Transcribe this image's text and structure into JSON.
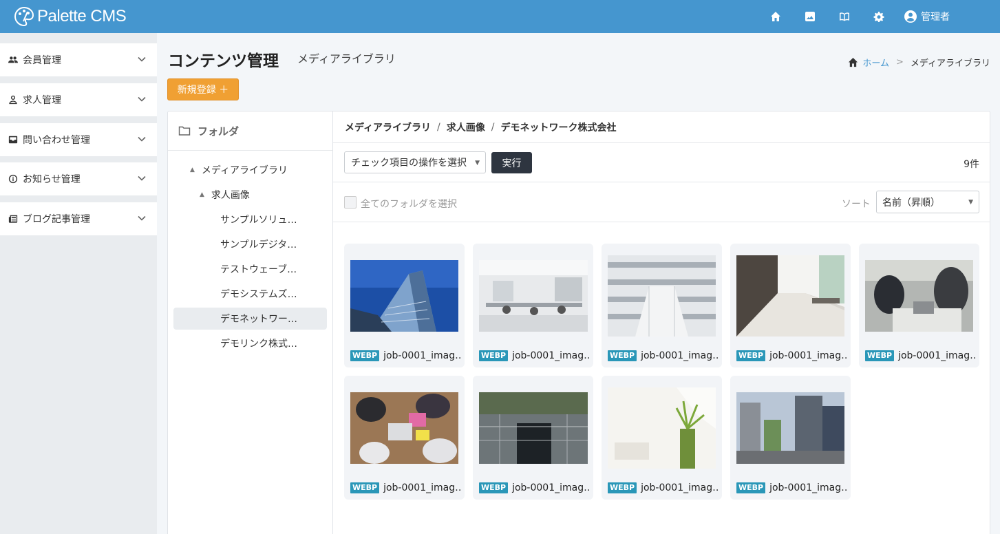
{
  "app": {
    "name": "Palette CMS"
  },
  "topbar": {
    "icons": [
      "home-icon",
      "image-icon",
      "book-icon",
      "gear-icon"
    ],
    "user_label": "管理者"
  },
  "sidebar": {
    "items": [
      {
        "label": "会員管理",
        "icon": "users-icon"
      },
      {
        "label": "求人管理",
        "icon": "user-icon"
      },
      {
        "label": "問い合わせ管理",
        "icon": "inbox-icon"
      },
      {
        "label": "お知らせ管理",
        "icon": "info-icon"
      },
      {
        "label": "ブログ記事管理",
        "icon": "newspaper-icon"
      }
    ]
  },
  "page": {
    "title": "コンテンツ管理",
    "subtitle": "メディアライブラリ",
    "new_button": "新規登録 ＋"
  },
  "breadcrumb": {
    "home": "ホーム",
    "sep": ">",
    "current": "メディアライブラリ"
  },
  "folders": {
    "header": "フォルダ",
    "tree": [
      {
        "label": "メディアライブラリ",
        "level": 0,
        "expanded": true
      },
      {
        "label": "求人画像",
        "level": 1,
        "expanded": true
      },
      {
        "label": "サンプルソリュ…",
        "level": 2
      },
      {
        "label": "サンプルデジタ…",
        "level": 2
      },
      {
        "label": "テストウェーブ…",
        "level": 2
      },
      {
        "label": "デモシステムズ…",
        "level": 2
      },
      {
        "label": "デモネットワー…",
        "level": 2,
        "selected": true
      },
      {
        "label": "デモリンク株式…",
        "level": 2
      }
    ]
  },
  "content": {
    "path": [
      "メディアライブラリ",
      "求人画像",
      "デモネットワーク株式会社"
    ],
    "path_sep": "/",
    "bulk_select": "チェック項目の操作を選択",
    "exec_button": "実行",
    "count": "9件",
    "select_all": "全てのフォルダを選択",
    "sort_label": "ソート",
    "sort_value": "名前（昇順）"
  },
  "media": [
    {
      "badge": "WEBP",
      "name": "job-0001_imag…",
      "scene": "skyscraper"
    },
    {
      "badge": "WEBP",
      "name": "job-0001_imag…",
      "scene": "office"
    },
    {
      "badge": "WEBP",
      "name": "job-0001_imag…",
      "scene": "library"
    },
    {
      "badge": "WEBP",
      "name": "job-0001_imag…",
      "scene": "hallway"
    },
    {
      "badge": "WEBP",
      "name": "job-0001_imag…",
      "scene": "meeting"
    },
    {
      "badge": "WEBP",
      "name": "job-0001_imag…",
      "scene": "desk-team"
    },
    {
      "badge": "WEBP",
      "name": "job-0001_imag…",
      "scene": "entrance"
    },
    {
      "badge": "WEBP",
      "name": "job-0001_imag…",
      "scene": "plant-room"
    },
    {
      "badge": "WEBP",
      "name": "job-0001_imag…",
      "scene": "city-street"
    }
  ],
  "colors": {
    "topbar": "#4596cf",
    "accent": "#f0a033",
    "badge": "#2a97b8",
    "exec": "#2e3540"
  }
}
